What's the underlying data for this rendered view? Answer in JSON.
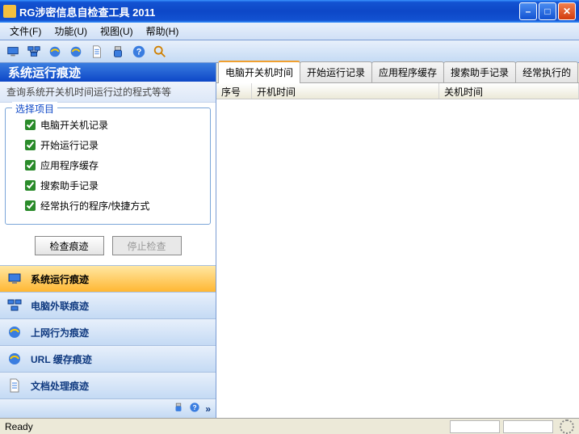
{
  "window": {
    "title": "RG涉密信息自检查工具 2011"
  },
  "menu": {
    "file": "文件(F)",
    "function": "功能(U)",
    "view": "视图(U)",
    "help": "帮助(H)"
  },
  "sidebar": {
    "header": "系统运行痕迹",
    "desc": "查询系统开关机时间运行过的程式等等",
    "fieldset_legend": "选择项目",
    "checks": [
      "电脑开关机记录",
      "开始运行记录",
      "应用程序缓存",
      "搜索助手记录",
      "经常执行的程序/快捷方式"
    ],
    "btn_check": "检查痕迹",
    "btn_stop": "停止检查",
    "nav": [
      "系统运行痕迹",
      "电脑外联痕迹",
      "上网行为痕迹",
      "URL 缓存痕迹",
      "文档处理痕迹"
    ]
  },
  "tabs": [
    "电脑开关机时间",
    "开始运行记录",
    "应用程序缓存",
    "搜索助手记录",
    "经常执行的"
  ],
  "columns": {
    "seq": "序号",
    "on": "开机时间",
    "off": "关机时间"
  },
  "status": "Ready"
}
